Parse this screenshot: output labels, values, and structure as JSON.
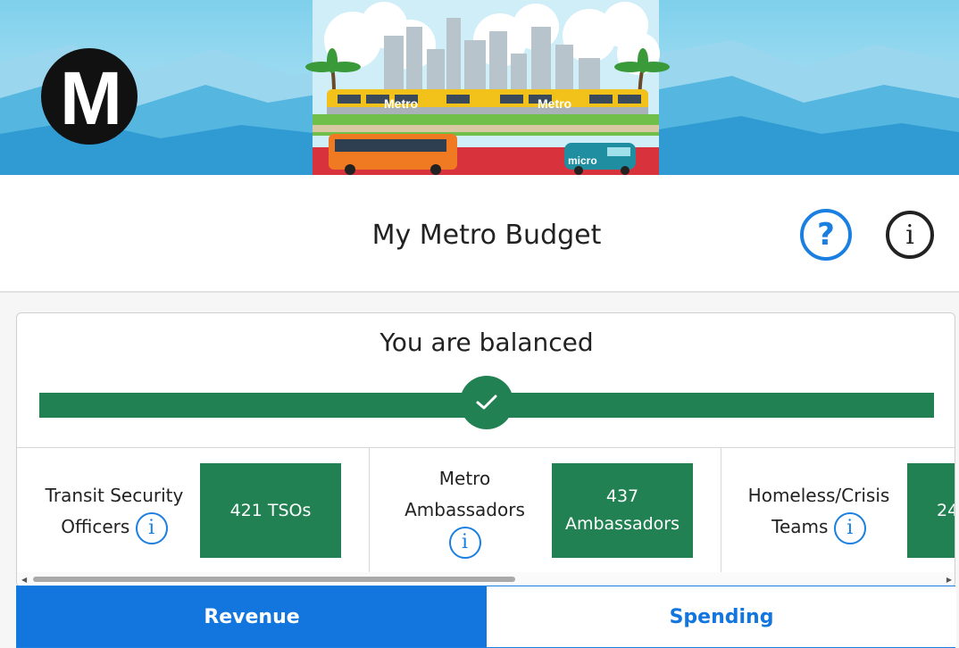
{
  "header": {
    "logo_letter": "M",
    "train_label": "Metro",
    "micro_label": "micro"
  },
  "titlebar": {
    "title": "My Metro Budget",
    "help_symbol": "?",
    "info_symbol": "i"
  },
  "balance": {
    "status": "You are balanced",
    "color": "#228152"
  },
  "items": [
    {
      "label_lines": [
        "Transit Security",
        "Officers"
      ],
      "value_lines": [
        "421 TSOs"
      ]
    },
    {
      "label_lines": [
        "Metro",
        "Ambassadors"
      ],
      "value_lines": [
        "437",
        "Ambassadors"
      ]
    },
    {
      "label_lines": [
        "Homeless/Crisis",
        "Teams"
      ],
      "value_lines": [
        "24"
      ]
    }
  ],
  "tabs": {
    "revenue": "Revenue",
    "spending": "Spending"
  },
  "colors": {
    "accent": "#1276de",
    "green": "#228152"
  }
}
